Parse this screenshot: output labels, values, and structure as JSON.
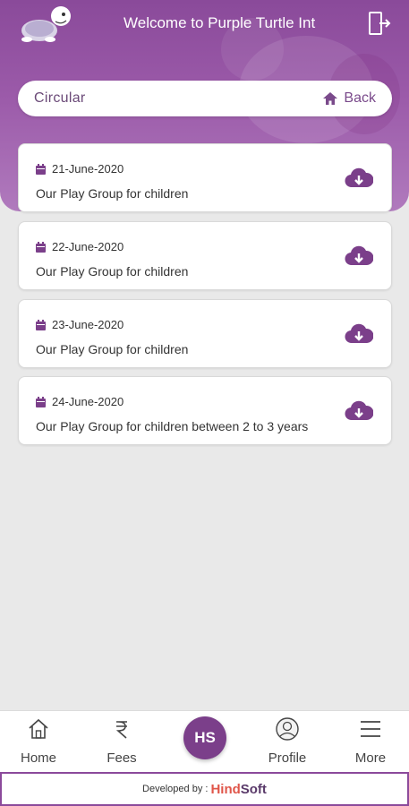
{
  "header": {
    "welcome_text": "Welcome to Purple Turtle Int"
  },
  "circular_bar": {
    "title": "Circular",
    "back_label": "Back"
  },
  "circulars": [
    {
      "date": "21-June-2020",
      "description": "Our Play Group for children"
    },
    {
      "date": "22-June-2020",
      "description": "Our Play Group for children"
    },
    {
      "date": "23-June-2020",
      "description": "Our Play Group for children"
    },
    {
      "date": "24-June-2020",
      "description": "Our Play Group for children between 2 to 3 years"
    }
  ],
  "bottom_nav": {
    "items": [
      {
        "label": "Home",
        "icon": "home-icon"
      },
      {
        "label": "Fees",
        "icon": "rupee-icon"
      },
      {
        "label": "Profile",
        "icon": "profile-icon"
      },
      {
        "label": "More",
        "icon": "menu-icon"
      }
    ],
    "center_button": "HS"
  },
  "footer": {
    "developed_by": "Developed by :",
    "brand_part1": "Hind",
    "brand_part2": "Soft"
  },
  "colors": {
    "brand_purple": "#7b3f8a",
    "background": "#e9e9e9"
  }
}
